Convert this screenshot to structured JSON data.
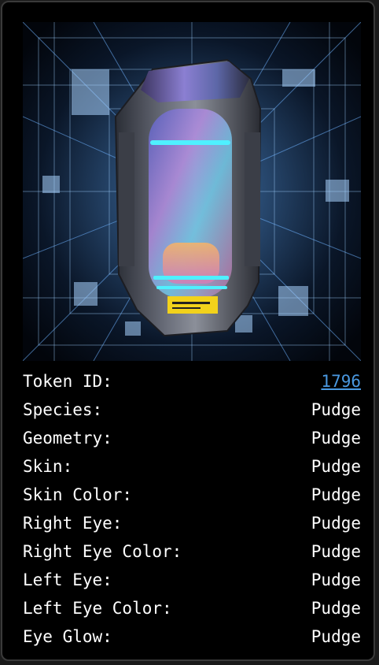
{
  "card": {
    "image_description_name": "capsule-artwork",
    "token": {
      "label": "Token ID:",
      "value": "1796",
      "link_color": "#4a98e0"
    },
    "traits": [
      {
        "label": "Species:",
        "value": "Pudge"
      },
      {
        "label": "Geometry:",
        "value": "Pudge"
      },
      {
        "label": "Skin:",
        "value": "Pudge"
      },
      {
        "label": "Skin Color:",
        "value": "Pudge"
      },
      {
        "label": "Right Eye:",
        "value": "Pudge"
      },
      {
        "label": "Right Eye Color:",
        "value": "Pudge"
      },
      {
        "label": "Left Eye:",
        "value": "Pudge"
      },
      {
        "label": "Left Eye Color:",
        "value": "Pudge"
      },
      {
        "label": "Eye Glow:",
        "value": "Pudge"
      }
    ]
  },
  "colors": {
    "background": "#000000",
    "text": "#ffffff",
    "accent_cyan": "#4ff0ff",
    "accent_yellow": "#f2d21b"
  }
}
